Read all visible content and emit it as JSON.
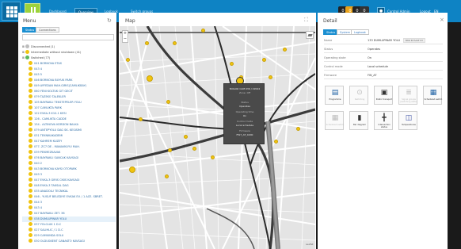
{
  "header": {
    "nav": [
      "Dashboard",
      "Overview",
      "Logbook",
      "Switch groups"
    ],
    "active_nav": "Overview",
    "icon_labels": [
      "0",
      "0",
      "0",
      "0"
    ],
    "user_text": "Control Admin",
    "logout": "Logout",
    "lang": "EN"
  },
  "menu": {
    "title": "Menu",
    "tabs": [
      "Status",
      "Connections"
    ],
    "search_placeholder": "",
    "root_items": [
      {
        "label": "Disconnected (1)",
        "color": "#bdbdbd"
      },
      {
        "label": "Intermediate without shutdown (41)",
        "color": "#f1c40f"
      },
      {
        "label": "Switched (77)",
        "color": "#5cb85c"
      }
    ],
    "items": [
      "041 BORNOVA ETAS",
      "043 4",
      "045 5",
      "046 BORNOVA BUYUK PARK",
      "049 AYFEDAN MAH.GIRIS(CAMLIKBAY)",
      "060 YENI KOLTUK GIT GECIT",
      "079 TAZEKO TALEKLER",
      "105 BAYRAKLI TEKSTEPELER YOLU",
      "107 CAMLIKTA PARK",
      "122 EVKA-3 K10-1 KESI",
      "126 - CAMLIKTA CADDE",
      "134 - ALTINOVA KORDON BALKA",
      "079 ANTEPYOLU DAG SK. KESISIMI",
      "031 TEKNIKAKADEMI",
      "047 KAHREM KUZEY",
      "077- ZC7 DE - MANAVKUYU MAH.",
      "039 PEKMEZKAVAK",
      "076 BAYRAKLI SANCAK KAVSAGI",
      "040 2",
      "043 BORNOVA KAYSI OTOPARK",
      "049 3",
      "047 EVKA-3 GIRIS CIKIS KAVSAGI",
      "048 EVKA-3 TAKSAL DAG",
      "035 ANADOLU TECNIKAL",
      "046 - YUSUF BELEDIYE EVKAK EV. / 1 ACE. SBRET.",
      "044 3",
      "043 4",
      "047 BAYRAKLI ZET. 36",
      "038 DUMLUPINAR YOLU",
      "037 YOLCLUK 1 D.C",
      "027 SALIHLIC / 1 D.C",
      "029 CAMIUNDA SOLU",
      "030 OLDUGKENT CANAKTO KAVSAGI"
    ]
  },
  "map": {
    "title": "Map",
    "zoom_in": "+",
    "zoom_out": "−",
    "attribution": "Leaflet",
    "popup": {
      "name": "BULVAR CAM 036 / 22024",
      "sub": "Zone: Off",
      "status_label": "Status",
      "status_value": "Operates",
      "operating_label": "Operating time",
      "operating_value": "On",
      "control_label": "Control mode",
      "control_value": "Local schedule",
      "firmware_label": "Firmware",
      "firmware_value": "FW7_AT_0200"
    }
  },
  "detail": {
    "title": "Detail",
    "close": "×",
    "tabs": [
      "Status",
      "System",
      "Logbook"
    ],
    "fields": [
      {
        "label": "Name",
        "value": "133 DUMLUPINAR YOLU",
        "tag": "BASI 48 SAAT 03"
      },
      {
        "label": "Status",
        "value": "Operates"
      },
      {
        "label": "Operating state",
        "value": "On"
      },
      {
        "label": "Control mode",
        "value": "Local schedule"
      },
      {
        "label": "Firmware",
        "value": "FW_AT"
      }
    ],
    "actions": [
      {
        "label": "Programme",
        "icon": "programme-icon",
        "dim": false
      },
      {
        "label": "Switching",
        "icon": "switch-icon",
        "dim": true
      },
      {
        "label": "Public transport",
        "icon": "bus-icon",
        "dim": false
      },
      {
        "label": "Signal groups (switching state)",
        "icon": "signal-groups-icon",
        "dim": true
      },
      {
        "label": "Scheduled switch",
        "icon": "calendar-icon",
        "dim": false
      },
      {
        "label": "Scheduled switch",
        "icon": "calendar-dim-icon",
        "dim": true
      },
      {
        "label": "Bar diagram",
        "icon": "bar-diagram-icon",
        "dim": false
      },
      {
        "label": "Intersection status",
        "icon": "intersection-icon",
        "dim": false
      },
      {
        "label": "Temperatures",
        "icon": "temperature-icon",
        "dim": false
      }
    ]
  },
  "colors": {
    "brand": "#0e83c4",
    "accent": "#1b8fd1",
    "marker": "#f1c40f",
    "ok": "#5cb85c"
  }
}
